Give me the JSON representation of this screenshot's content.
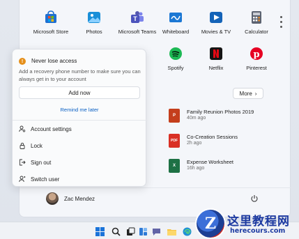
{
  "pinned_apps": [
    {
      "label": "Microsoft Store",
      "icon": "store-icon",
      "color": "#1f6fd1"
    },
    {
      "label": "Photos",
      "icon": "photos-icon",
      "color": "#1a8fd8"
    },
    {
      "label": "Microsoft Teams",
      "icon": "teams-icon",
      "color": "#5558af"
    },
    {
      "label": "Whiteboard",
      "icon": "whiteboard-icon",
      "color": "#1c78d4"
    },
    {
      "label": "Movies & TV",
      "icon": "movies-icon",
      "color": "#1463b8"
    },
    {
      "label": "Calculator",
      "icon": "calculator-icon",
      "color": "#5b6270"
    },
    {
      "label": "Spotify",
      "icon": "spotify-icon",
      "color": "#1db954"
    },
    {
      "label": "Netflix",
      "icon": "netflix-icon",
      "color": "#e50914"
    },
    {
      "label": "Pinterest",
      "icon": "pinterest-icon",
      "color": "#e60023"
    }
  ],
  "more_button": {
    "label": "More",
    "chevron": "›"
  },
  "recommended": [
    {
      "title": "Family Reunion Photos 2019",
      "subtitle": "40m ago",
      "icon": "powerpoint-file-icon",
      "color": "#c43e1c",
      "badge": "P"
    },
    {
      "title": "Co-Creation Sessions",
      "subtitle": "2h ago",
      "icon": "pdf-file-icon",
      "color": "#d93025",
      "badge": "PDF"
    },
    {
      "title": "Expense Worksheet",
      "subtitle": "16h ago",
      "icon": "excel-file-icon",
      "color": "#1e7145",
      "badge": "X"
    }
  ],
  "account_flyout": {
    "warning_title": "Never lose access",
    "warning_text": "Add a recovery phone number to make sure you can always get in to your account",
    "add_now_label": "Add now",
    "remind_label": "Remind me later",
    "menu": [
      {
        "label": "Account settings",
        "icon": "account-settings-icon"
      },
      {
        "label": "Lock",
        "icon": "lock-icon"
      },
      {
        "label": "Sign out",
        "icon": "sign-out-icon"
      },
      {
        "label": "Switch user",
        "icon": "switch-user-icon"
      }
    ]
  },
  "user": {
    "name": "Zac Mendez"
  },
  "watermark": {
    "title": "这里教程网",
    "url": "herecours.com",
    "letter": "Z"
  },
  "colors": {
    "link": "#0a60c4",
    "warning": "#e58f1a",
    "accent": "#1d3aa1"
  }
}
